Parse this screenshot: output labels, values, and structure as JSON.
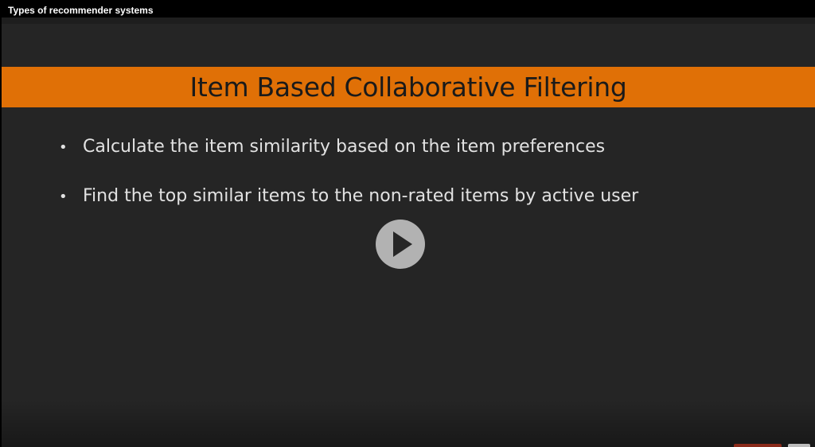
{
  "video": {
    "title": "Types of recommender systems"
  },
  "slide": {
    "title": "Item Based Collaborative Filtering",
    "bullets": [
      "Calculate the item similarity based on the item preferences",
      "Find the top similar items to the non-rated items by active user"
    ],
    "bullet_glyph": "•"
  },
  "controls": {
    "play_icon": "play-icon"
  },
  "colors": {
    "title_band": "#e07006",
    "slide_background": "#252525",
    "bullet_text": "#e2e2e2"
  }
}
